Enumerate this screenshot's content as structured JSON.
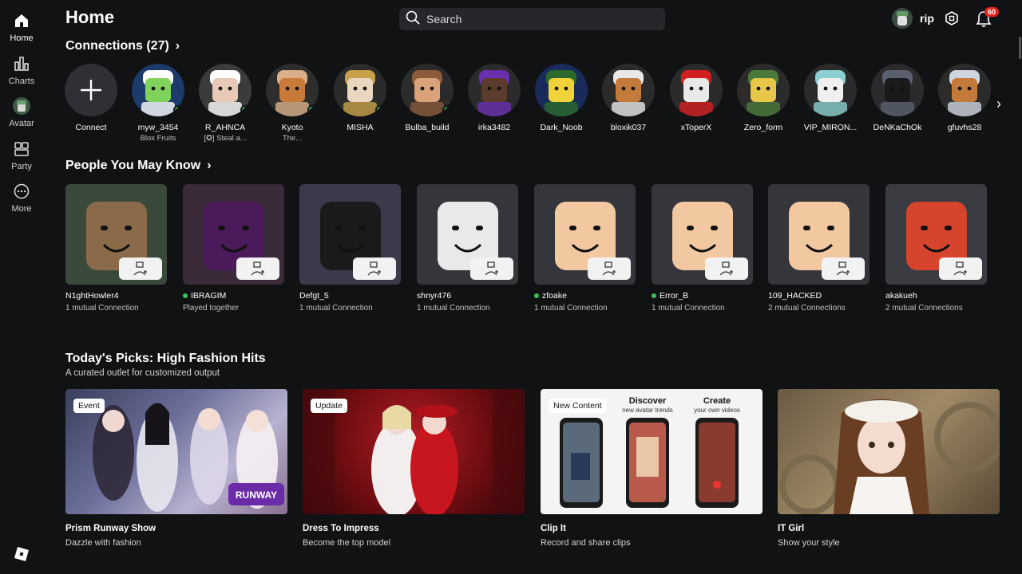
{
  "sidebar": {
    "items": [
      {
        "label": "Home",
        "icon": "home-icon"
      },
      {
        "label": "Charts",
        "icon": "charts-icon"
      },
      {
        "label": "Avatar",
        "icon": "avatar-icon"
      },
      {
        "label": "Party",
        "icon": "party-icon"
      },
      {
        "label": "More",
        "icon": "more-icon"
      }
    ]
  },
  "header": {
    "title": "Home",
    "search_placeholder": "Search",
    "username": "rip",
    "notification_count": "60"
  },
  "connections": {
    "title": "Connections (27)",
    "connect_label": "Connect",
    "items": [
      {
        "name": "myw_3454",
        "sub": "Blox Fruits",
        "online": true
      },
      {
        "name": "R_AHNCA",
        "sub": "[✪] Steal a...",
        "online": true
      },
      {
        "name": "Kyoto",
        "sub": "The...",
        "online": true
      },
      {
        "name": "MISHA",
        "sub": "",
        "online": true
      },
      {
        "name": "Bulba_build",
        "sub": "",
        "online": true
      },
      {
        "name": "irka3482",
        "sub": "",
        "online": false
      },
      {
        "name": "Dark_Noob",
        "sub": "",
        "online": false
      },
      {
        "name": "bloxik037",
        "sub": "",
        "online": false
      },
      {
        "name": "xToperX",
        "sub": "",
        "online": false
      },
      {
        "name": "Zero_form",
        "sub": "",
        "online": false
      },
      {
        "name": "VIP_MIRON...",
        "sub": "",
        "online": false
      },
      {
        "name": "DeNKaChOk",
        "sub": "",
        "online": false
      },
      {
        "name": "gfuvhs28",
        "sub": "",
        "online": false
      }
    ]
  },
  "people": {
    "title": "People You May Know",
    "items": [
      {
        "name": "N1ghtHowler4",
        "sub": "1 mutual Connection",
        "online": false
      },
      {
        "name": "IBRAGIM",
        "sub": "Played together",
        "online": true
      },
      {
        "name": "Defgt_5",
        "sub": "1 mutual Connection",
        "online": false
      },
      {
        "name": "shnyr476",
        "sub": "1 mutual Connection",
        "online": false
      },
      {
        "name": "zfoake",
        "sub": "1 mutual Connection",
        "online": true
      },
      {
        "name": "Error_B",
        "sub": "1 mutual Connection",
        "online": true
      },
      {
        "name": "109_HACKED",
        "sub": "2 mutual Connections",
        "online": false
      },
      {
        "name": "akakueh",
        "sub": "2 mutual Connections",
        "online": false
      }
    ]
  },
  "picks": {
    "title": "Today's Picks: High Fashion Hits",
    "subtitle": "A curated outlet for customized output",
    "items": [
      {
        "tag": "Event",
        "title": "Prism Runway Show",
        "sub": "Dazzle with fashion",
        "logo_text": "RUNWAY"
      },
      {
        "tag": "Update",
        "title": "Dress To Impress",
        "sub": "Become the top model"
      },
      {
        "tag": "New Content",
        "title": "Clip It",
        "sub": "Record and share clips",
        "promo_left_title": "Discover",
        "promo_left_sub": "new avatar trends",
        "promo_right_title": "Create",
        "promo_right_sub": "your own videos"
      },
      {
        "tag": "",
        "title": "IT Girl",
        "sub": "Show your style"
      }
    ]
  },
  "colors": {
    "background": "#111214",
    "online": "#39c256",
    "badge": "#e2231a"
  }
}
